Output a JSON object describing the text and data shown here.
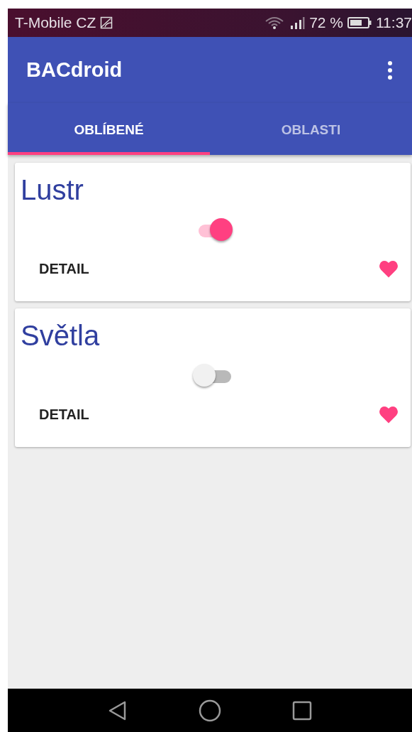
{
  "status_bar": {
    "carrier": "T-Mobile CZ",
    "battery": "72 %",
    "time": "11:37"
  },
  "app_bar": {
    "title": "BACdroid"
  },
  "tabs": [
    {
      "label": "OBLÍBENÉ",
      "selected": true
    },
    {
      "label": "OBLASTI",
      "selected": false
    }
  ],
  "devices": [
    {
      "name": "Lustr",
      "on": true,
      "favorite": true,
      "action": "DETAIL"
    },
    {
      "name": "Světla",
      "on": false,
      "favorite": true,
      "action": "DETAIL"
    }
  ]
}
